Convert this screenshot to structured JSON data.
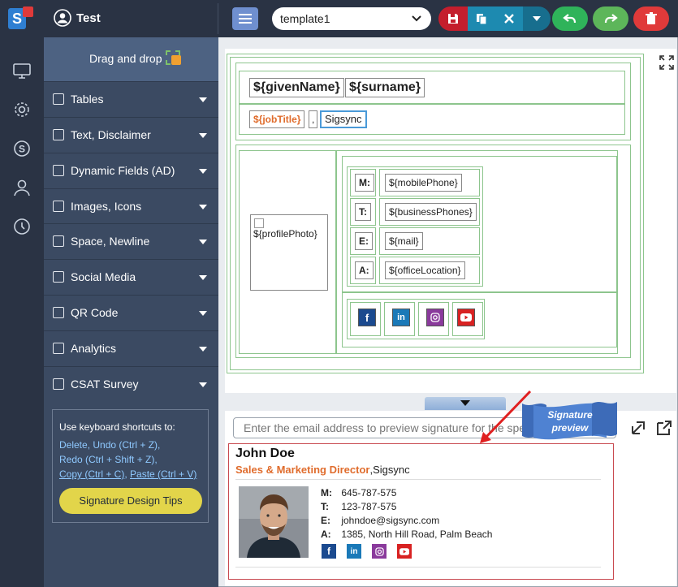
{
  "header": {
    "user_name": "Test",
    "template_select": "template1"
  },
  "sidebar": {
    "drag_drop": "Drag and drop",
    "items": [
      {
        "label": "Tables"
      },
      {
        "label": "Text, Disclaimer"
      },
      {
        "label": "Dynamic Fields (AD)"
      },
      {
        "label": "Images, Icons"
      },
      {
        "label": "Space, Newline"
      },
      {
        "label": "Social Media"
      },
      {
        "label": "QR Code"
      },
      {
        "label": "Analytics"
      },
      {
        "label": "CSAT Survey"
      }
    ],
    "tips": {
      "intro": "Use keyboard shortcuts to:",
      "delete": "Delete",
      "undo": "Undo (Ctrl + Z),",
      "redo": "Redo (Ctrl + Shift + Z),",
      "copy": "Copy (Ctrl + C)",
      "paste": "Paste (Ctrl + V)",
      "button": "Signature Design Tips"
    }
  },
  "editor": {
    "given_name": "${givenName}",
    "surname": "${surname}",
    "job_title": "${jobTitle}",
    "comma": ",",
    "company": "Sigsync",
    "photo": "${profilePhoto}",
    "rows": [
      {
        "label": "M:",
        "value": "${mobilePhone}"
      },
      {
        "label": "T:",
        "value": "${businessPhones}"
      },
      {
        "label": "E:",
        "value": "${mail}"
      },
      {
        "label": "A:",
        "value": "${officeLocation}"
      }
    ]
  },
  "preview": {
    "email_placeholder": "Enter the email address to preview signature for the specific",
    "badge": "Signature preview",
    "name": "John Doe",
    "job_title": "Sales & Marketing Director",
    "company": "Sigsync",
    "rows": [
      {
        "label": "M:",
        "value": "645-787-575"
      },
      {
        "label": "T:",
        "value": "123-787-575"
      },
      {
        "label": "E:",
        "value": "johndoe@sigsync.com"
      },
      {
        "label": "A:",
        "value": "1385, North Hill Road, Palm Beach"
      }
    ]
  },
  "colors": {
    "facebook": "#1b4a8f",
    "linkedin": "#1a79b8",
    "instagram": "#8a3a9c",
    "youtube": "#d82222",
    "accent_orange": "#e06c2c"
  }
}
